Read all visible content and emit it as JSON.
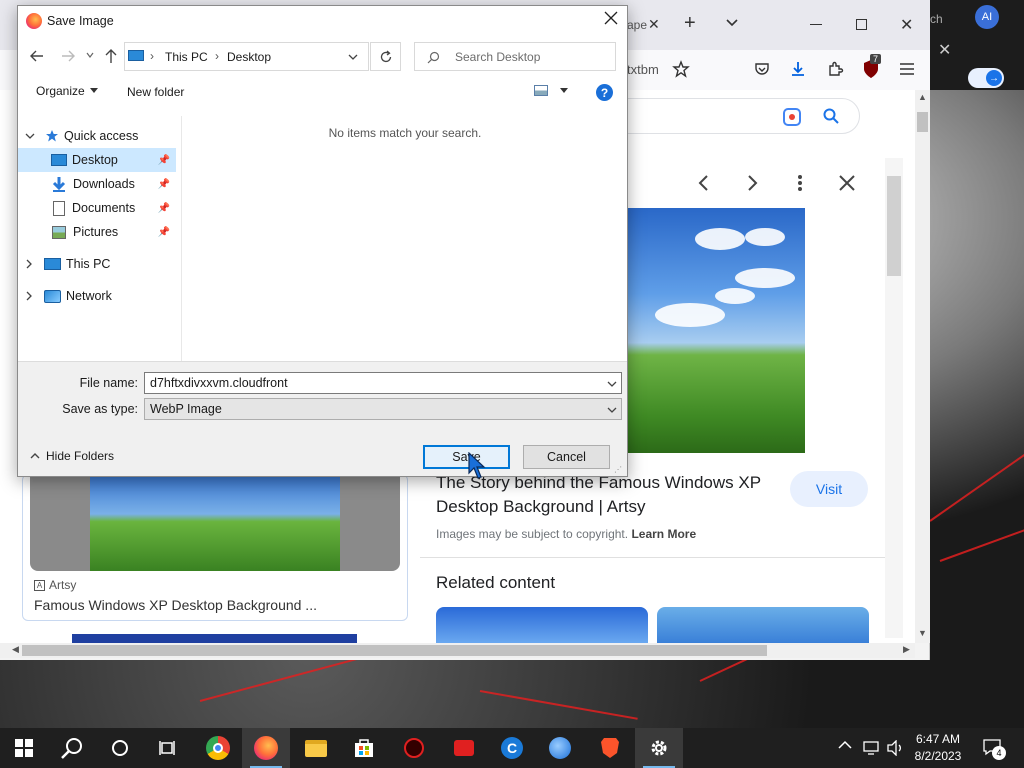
{
  "browser": {
    "tab_partial_1": "ape",
    "tab_partial_2": "ch",
    "url_partial": "txtbm",
    "avatar_initials": "AI",
    "extension_badge": "7"
  },
  "google": {
    "result_title": "The Story behind the Famous Windows XP Desktop Background | Artsy",
    "visit_label": "Visit",
    "copyright_text": "Images may be subject to copyright.",
    "learn_more": "Learn More",
    "related_heading": "Related content",
    "card_source": "Artsy",
    "card_title": "Famous Windows XP Desktop Background ..."
  },
  "dialog": {
    "title": "Save Image",
    "breadcrumb": [
      "This PC",
      "Desktop"
    ],
    "search_placeholder": "Search Desktop",
    "organize_label": "Organize",
    "new_folder_label": "New folder",
    "empty_message": "No items match your search.",
    "nav": {
      "quick_access": "Quick access",
      "desktop": "Desktop",
      "downloads": "Downloads",
      "documents": "Documents",
      "pictures": "Pictures",
      "this_pc": "This PC",
      "network": "Network"
    },
    "file_name_label": "File name:",
    "file_name_value": "d7hftxdivxxvm.cloudfront",
    "save_as_type_label": "Save as type:",
    "save_as_type_value": "WebP Image",
    "hide_folders_label": "Hide Folders",
    "save_label": "Save",
    "cancel_label": "Cancel"
  },
  "taskbar": {
    "time": "6:47 AM",
    "date": "8/2/2023",
    "notification_count": "4"
  },
  "colors": {
    "accent": "#0078d7",
    "selection": "#cce8ff",
    "google_blue": "#1a73e8",
    "taskbar": "#1f1f1f"
  }
}
